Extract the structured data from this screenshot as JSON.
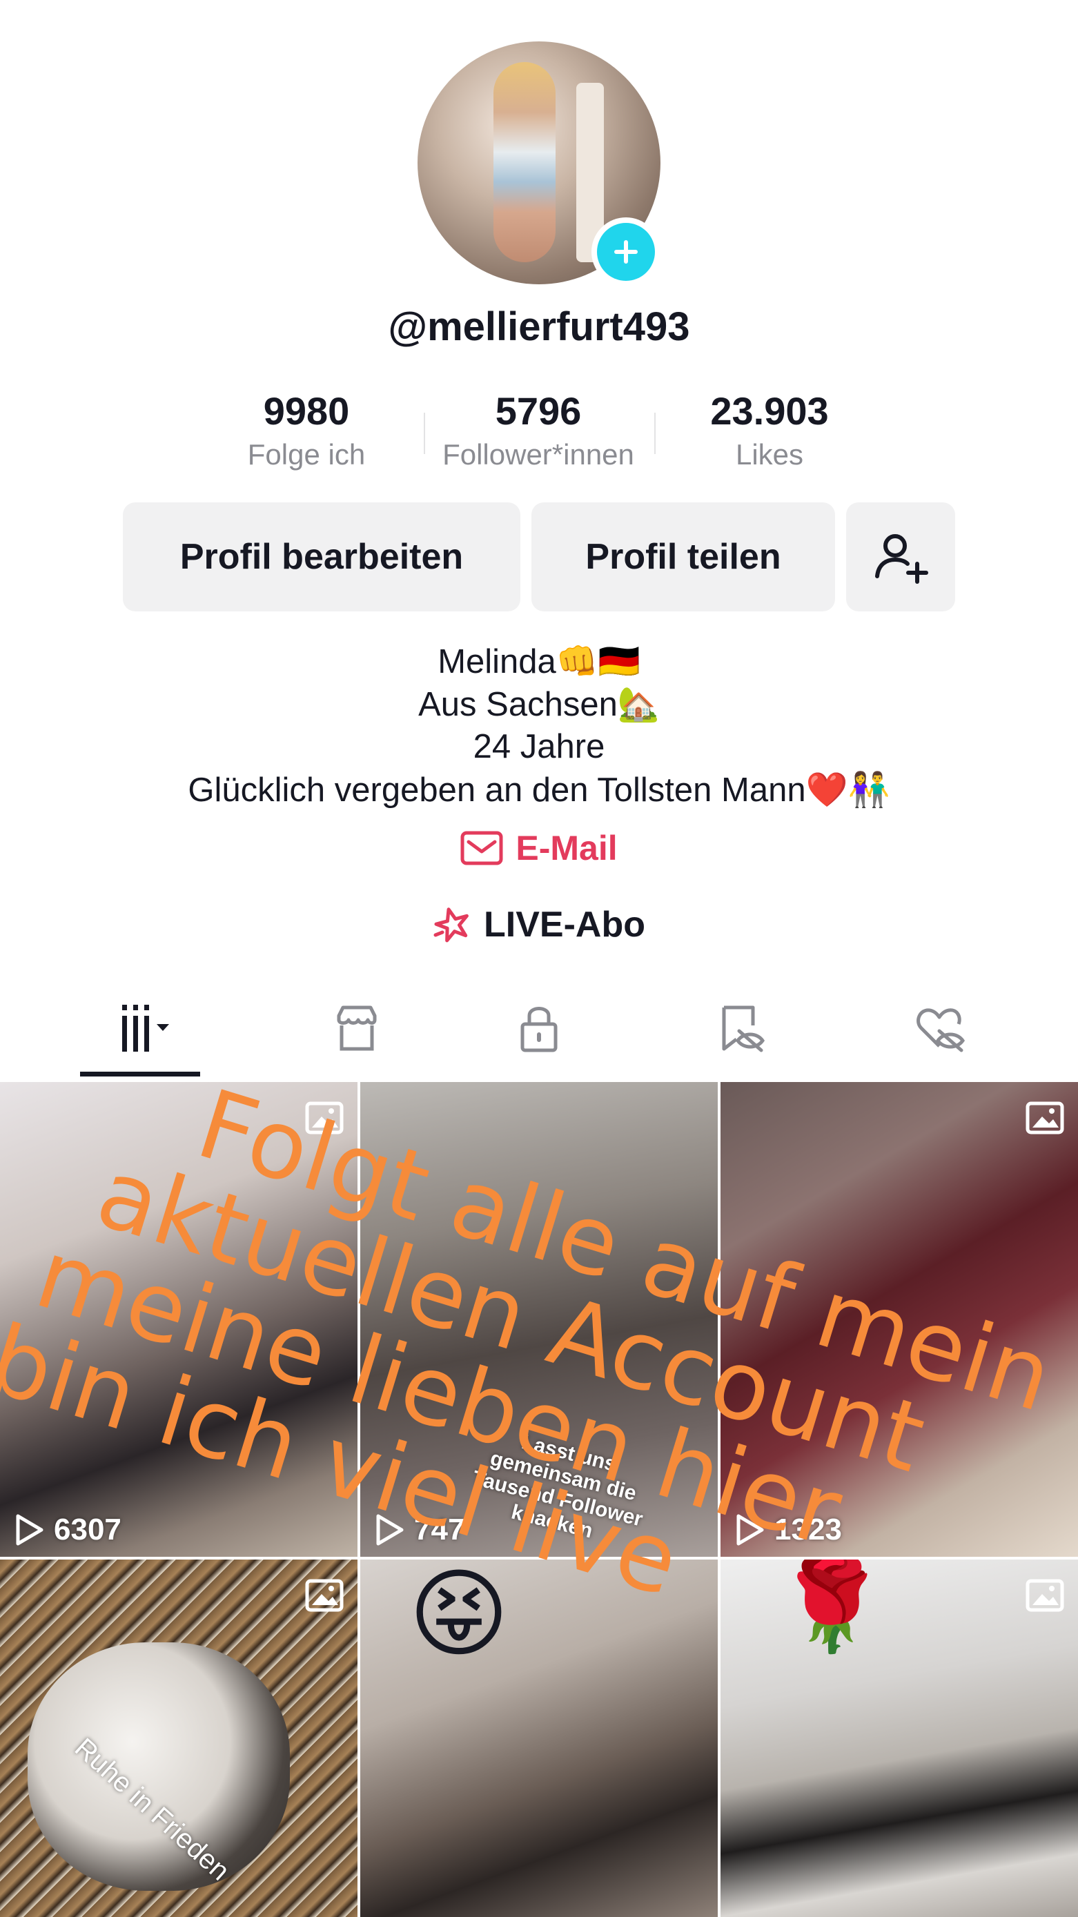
{
  "profile": {
    "username": "@mellierfurt493",
    "stats": [
      {
        "value": "9980",
        "label": "Folge ich"
      },
      {
        "value": "5796",
        "label": "Follower*innen"
      },
      {
        "value": "23.903",
        "label": "Likes"
      }
    ],
    "buttons": {
      "edit": "Profil bearbeiten",
      "share": "Profil teilen",
      "add_friend_icon": "person-add-icon"
    },
    "bio": [
      "Melinda👊🇩🇪",
      "Aus Sachsen🏡",
      "24 Jahre",
      "Glücklich vergeben an den Tollsten Mann❤️👫"
    ],
    "email_label": "E-Mail",
    "live_abo_label": "LIVE-Abo"
  },
  "tabs": [
    {
      "name": "videos-tab",
      "icon": "grid-bars-icon",
      "active": true
    },
    {
      "name": "shop-tab",
      "icon": "shop-icon"
    },
    {
      "name": "private-tab",
      "icon": "lock-icon"
    },
    {
      "name": "saved-tab",
      "icon": "bookmark-hidden-icon"
    },
    {
      "name": "liked-tab",
      "icon": "heart-hidden-icon"
    }
  ],
  "grid": [
    {
      "views": "6307",
      "type": "photo",
      "caption": ""
    },
    {
      "views": "747",
      "type": "video",
      "caption": "Lasst uns gemeinsam die Tausend Follower knacken"
    },
    {
      "views": "1323",
      "type": "photo",
      "caption": ""
    },
    {
      "views": "",
      "type": "photo",
      "caption": "Ruhe in Frieden"
    },
    {
      "views": "",
      "type": "video",
      "caption": "😝"
    },
    {
      "views": "",
      "type": "photo",
      "caption": "🌹"
    }
  ],
  "overlay_text": [
    "Folgt alle auf mein",
    "aktuellen Account",
    "meine lieben hier",
    "bin ich viel live"
  ],
  "colors": {
    "accent_cyan": "#20d5ec",
    "email_pink": "#e33b5c",
    "overlay_orange": "#f68b3a",
    "button_bg": "#f1f1f2",
    "muted_text": "#8a8b91"
  }
}
